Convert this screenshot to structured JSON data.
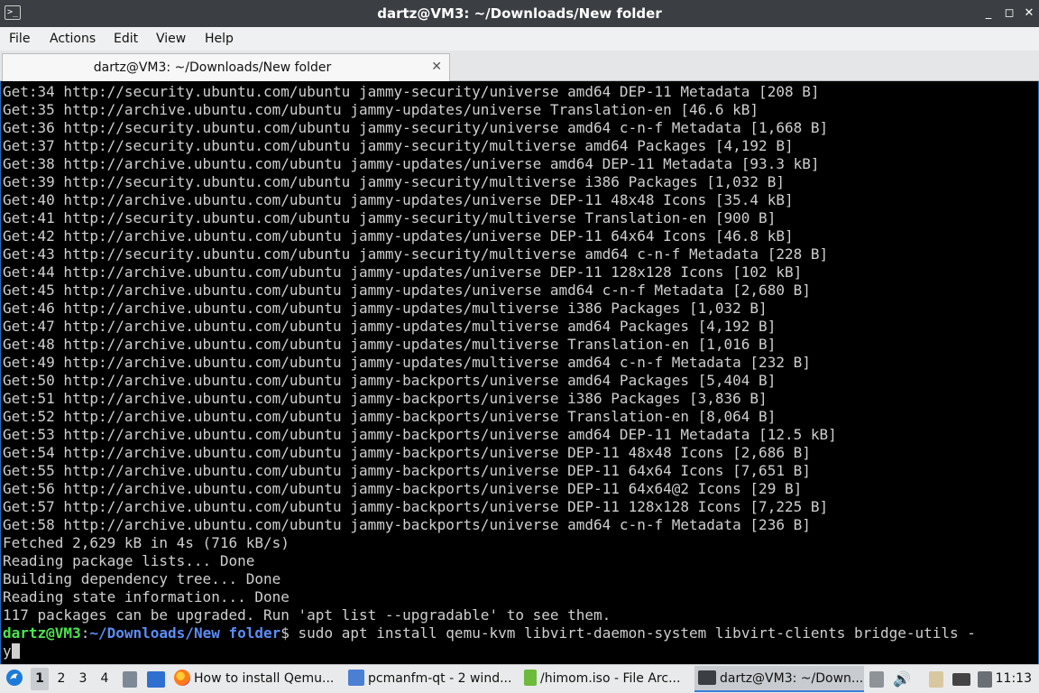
{
  "window": {
    "title": "dartz@VM3: ~/Downloads/New folder",
    "icon_text": ">_",
    "minimize_icon": "_",
    "restore_icon": "◻",
    "close_icon": "✕"
  },
  "menu": [
    "File",
    "Actions",
    "Edit",
    "View",
    "Help"
  ],
  "tab": {
    "label": "dartz@VM3: ~/Downloads/New folder",
    "close_icon": "✕"
  },
  "terminal": {
    "lines": [
      "Get:34 http://security.ubuntu.com/ubuntu jammy-security/universe amd64 DEP-11 Metadata [208 B]",
      "Get:35 http://archive.ubuntu.com/ubuntu jammy-updates/universe Translation-en [46.6 kB]",
      "Get:36 http://security.ubuntu.com/ubuntu jammy-security/universe amd64 c-n-f Metadata [1,668 B]",
      "Get:37 http://security.ubuntu.com/ubuntu jammy-security/multiverse amd64 Packages [4,192 B]",
      "Get:38 http://archive.ubuntu.com/ubuntu jammy-updates/universe amd64 DEP-11 Metadata [93.3 kB]",
      "Get:39 http://security.ubuntu.com/ubuntu jammy-security/multiverse i386 Packages [1,032 B]",
      "Get:40 http://archive.ubuntu.com/ubuntu jammy-updates/universe DEP-11 48x48 Icons [35.4 kB]",
      "Get:41 http://security.ubuntu.com/ubuntu jammy-security/multiverse Translation-en [900 B]",
      "Get:42 http://archive.ubuntu.com/ubuntu jammy-updates/universe DEP-11 64x64 Icons [46.8 kB]",
      "Get:43 http://security.ubuntu.com/ubuntu jammy-security/multiverse amd64 c-n-f Metadata [228 B]",
      "Get:44 http://archive.ubuntu.com/ubuntu jammy-updates/universe DEP-11 128x128 Icons [102 kB]",
      "Get:45 http://archive.ubuntu.com/ubuntu jammy-updates/universe amd64 c-n-f Metadata [2,680 B]",
      "Get:46 http://archive.ubuntu.com/ubuntu jammy-updates/multiverse i386 Packages [1,032 B]",
      "Get:47 http://archive.ubuntu.com/ubuntu jammy-updates/multiverse amd64 Packages [4,192 B]",
      "Get:48 http://archive.ubuntu.com/ubuntu jammy-updates/multiverse Translation-en [1,016 B]",
      "Get:49 http://archive.ubuntu.com/ubuntu jammy-updates/multiverse amd64 c-n-f Metadata [232 B]",
      "Get:50 http://archive.ubuntu.com/ubuntu jammy-backports/universe amd64 Packages [5,404 B]",
      "Get:51 http://archive.ubuntu.com/ubuntu jammy-backports/universe i386 Packages [3,836 B]",
      "Get:52 http://archive.ubuntu.com/ubuntu jammy-backports/universe Translation-en [8,064 B]",
      "Get:53 http://archive.ubuntu.com/ubuntu jammy-backports/universe amd64 DEP-11 Metadata [12.5 kB]",
      "Get:54 http://archive.ubuntu.com/ubuntu jammy-backports/universe DEP-11 48x48 Icons [2,686 B]",
      "Get:55 http://archive.ubuntu.com/ubuntu jammy-backports/universe DEP-11 64x64 Icons [7,651 B]",
      "Get:56 http://archive.ubuntu.com/ubuntu jammy-backports/universe DEP-11 64x64@2 Icons [29 B]",
      "Get:57 http://archive.ubuntu.com/ubuntu jammy-backports/universe DEP-11 128x128 Icons [7,225 B]",
      "Get:58 http://archive.ubuntu.com/ubuntu jammy-backports/universe amd64 c-n-f Metadata [236 B]",
      "Fetched 2,629 kB in 4s (716 kB/s)",
      "Reading package lists... Done",
      "Building dependency tree... Done",
      "Reading state information... Done",
      "117 packages can be upgraded. Run 'apt list --upgradable' to see them."
    ],
    "prompt": {
      "user_host": "dartz@VM3",
      "colon": ":",
      "path": "~/Downloads/New folder",
      "dollar": "$",
      "command": " sudo apt install qemu-kvm libvirt-daemon-system libvirt-clients bridge-utils -",
      "wrap": "y"
    },
    "colors": {
      "background": "#000000",
      "text": "#cfcfcf",
      "user_host": "#4ee44e",
      "path": "#5c8df6"
    }
  },
  "taskbar": {
    "start_icon": "start-menu-icon",
    "desktops": [
      "1",
      "2",
      "3",
      "4"
    ],
    "tasks": [
      {
        "label": "How to install Qemu...",
        "icon": "firefox-icon"
      },
      {
        "label": "pcmanfm-qt - 2 wind...",
        "icon": "folder-icon"
      },
      {
        "label": "/himom.iso - File Arc...",
        "icon": "archive-icon"
      },
      {
        "label": "dartz@VM3: ~/Down...",
        "icon": "terminal-icon"
      }
    ],
    "clock": "11:13"
  }
}
